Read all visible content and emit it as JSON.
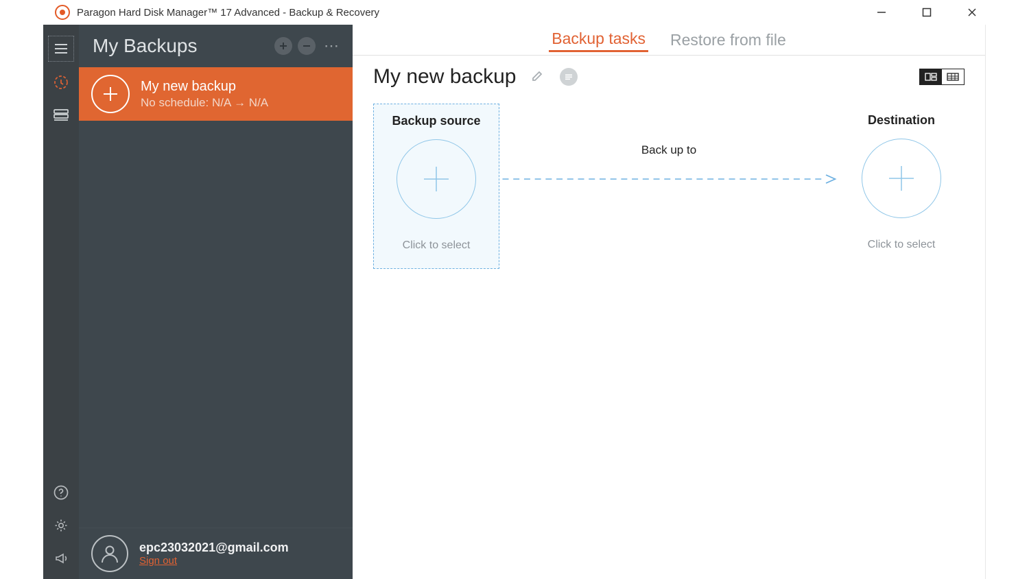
{
  "window_title": "Paragon Hard Disk Manager™ 17 Advanced - Backup & Recovery",
  "sidebar": {
    "title": "My Backups"
  },
  "backup_item": {
    "name": "My new backup",
    "subtitle": "No schedule: N/A → N/A"
  },
  "user": {
    "email": "epc23032021@gmail.com",
    "sign_out": "Sign out"
  },
  "tabs": {
    "backup_tasks": "Backup tasks",
    "restore_from_file": "Restore from file"
  },
  "content": {
    "title": "My new backup",
    "source": {
      "label": "Backup source",
      "hint": "Click to select"
    },
    "backup_to": "Back up to",
    "destination": {
      "label": "Destination",
      "hint": "Click to select"
    }
  }
}
